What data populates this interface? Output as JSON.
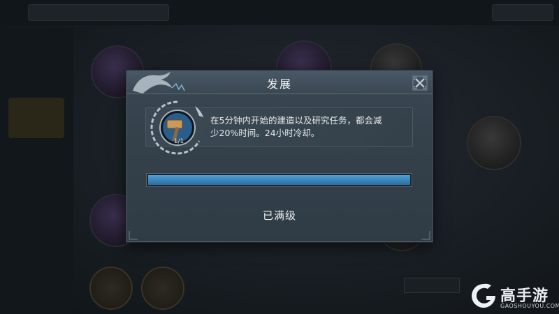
{
  "dialog": {
    "title": "发展",
    "skill": {
      "level_text": "1/1",
      "description_line1": "在5分钟内开始的建造以及研究任务，都会减",
      "description_line2": "少20%时间。24小时冷却。"
    },
    "progress": {
      "fraction": 1.0
    },
    "status_label": "已满级"
  },
  "watermark": {
    "brand": "高手游",
    "url": "GAOSHOUYOU.COM"
  },
  "colors": {
    "progress_fill": "#3a86bd",
    "dialog_bg": "#34414b",
    "title_text": "#eef1f3"
  }
}
